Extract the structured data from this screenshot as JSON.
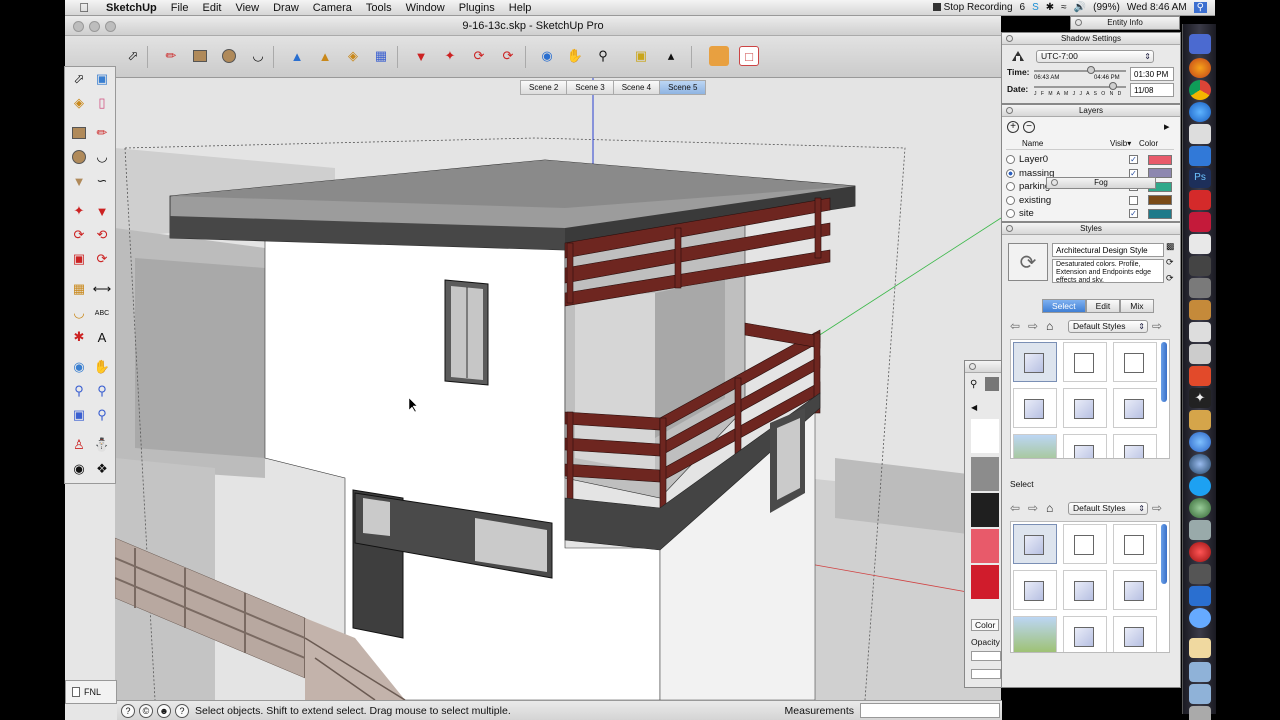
{
  "menubar": {
    "app_name": "SketchUp",
    "menus": [
      "File",
      "Edit",
      "View",
      "Draw",
      "Camera",
      "Tools",
      "Window",
      "Plugins",
      "Help"
    ],
    "recording_label": "Stop Recording",
    "input_badge": "6",
    "battery": "(99%)",
    "clock": "Wed 8:46 AM"
  },
  "window": {
    "title": "9-16-13c.skp - SketchUp Pro"
  },
  "scenes": {
    "tabs": [
      "Scene 2",
      "Scene 3",
      "Scene 4",
      "Scene 5"
    ],
    "active": "Scene 5"
  },
  "status": {
    "message": "Select objects. Shift to extend select. Drag mouse to select multiple.",
    "measurements_label": "Measurements",
    "lower_left_label": "FNL"
  },
  "entity_info": {
    "title": "Entity Info"
  },
  "shadow_settings": {
    "title": "Shadow Settings",
    "timezone": "UTC-7:00",
    "time_label": "Time:",
    "time_start": "06:43 AM",
    "time_end": "04:46 PM",
    "time_value": "01:30 PM",
    "time_position": 0.62,
    "date_label": "Date:",
    "months": "J F M A M J J A S O N D",
    "date_value": "11/08",
    "date_position": 0.86
  },
  "layers": {
    "title": "Layers",
    "col_name": "Name",
    "col_visible": "Visib▾",
    "col_color": "Color",
    "rows": [
      {
        "name": "Layer0",
        "visible": true,
        "color": "#e85a6a",
        "current": false
      },
      {
        "name": "massing",
        "visible": true,
        "color": "#8d87b0",
        "current": true
      },
      {
        "name": "parking",
        "visible": false,
        "color": "#2fa88a",
        "current": false
      },
      {
        "name": "existing",
        "visible": false,
        "color": "#7a4a17",
        "current": false
      },
      {
        "name": "site",
        "visible": true,
        "color": "#1f7a8a",
        "current": false
      }
    ]
  },
  "fog": {
    "title": "Fog"
  },
  "styles": {
    "title": "Styles",
    "style_name": "Architectural Design Style",
    "description": "Desaturated colors. Profile, Extension and Endpoints edge effects and sky.",
    "tabs": [
      "Select",
      "Edit",
      "Mix"
    ],
    "active_tab": "Select",
    "collection": "Default Styles",
    "secondary_label": "Select",
    "secondary_collection": "Default Styles"
  },
  "colors_panel": {
    "colors_label": "Color",
    "opacity_label": "Opacity",
    "swatches": [
      "#ffffff",
      "#8c8c8c",
      "#1f1f1f",
      "#e85a6a",
      "#d01c2c"
    ]
  },
  "palette_colors": {
    "viewport_bg": "#e4e4e4",
    "railing": "#6e2620",
    "roof": "#474747",
    "wall": "#ffffff"
  }
}
